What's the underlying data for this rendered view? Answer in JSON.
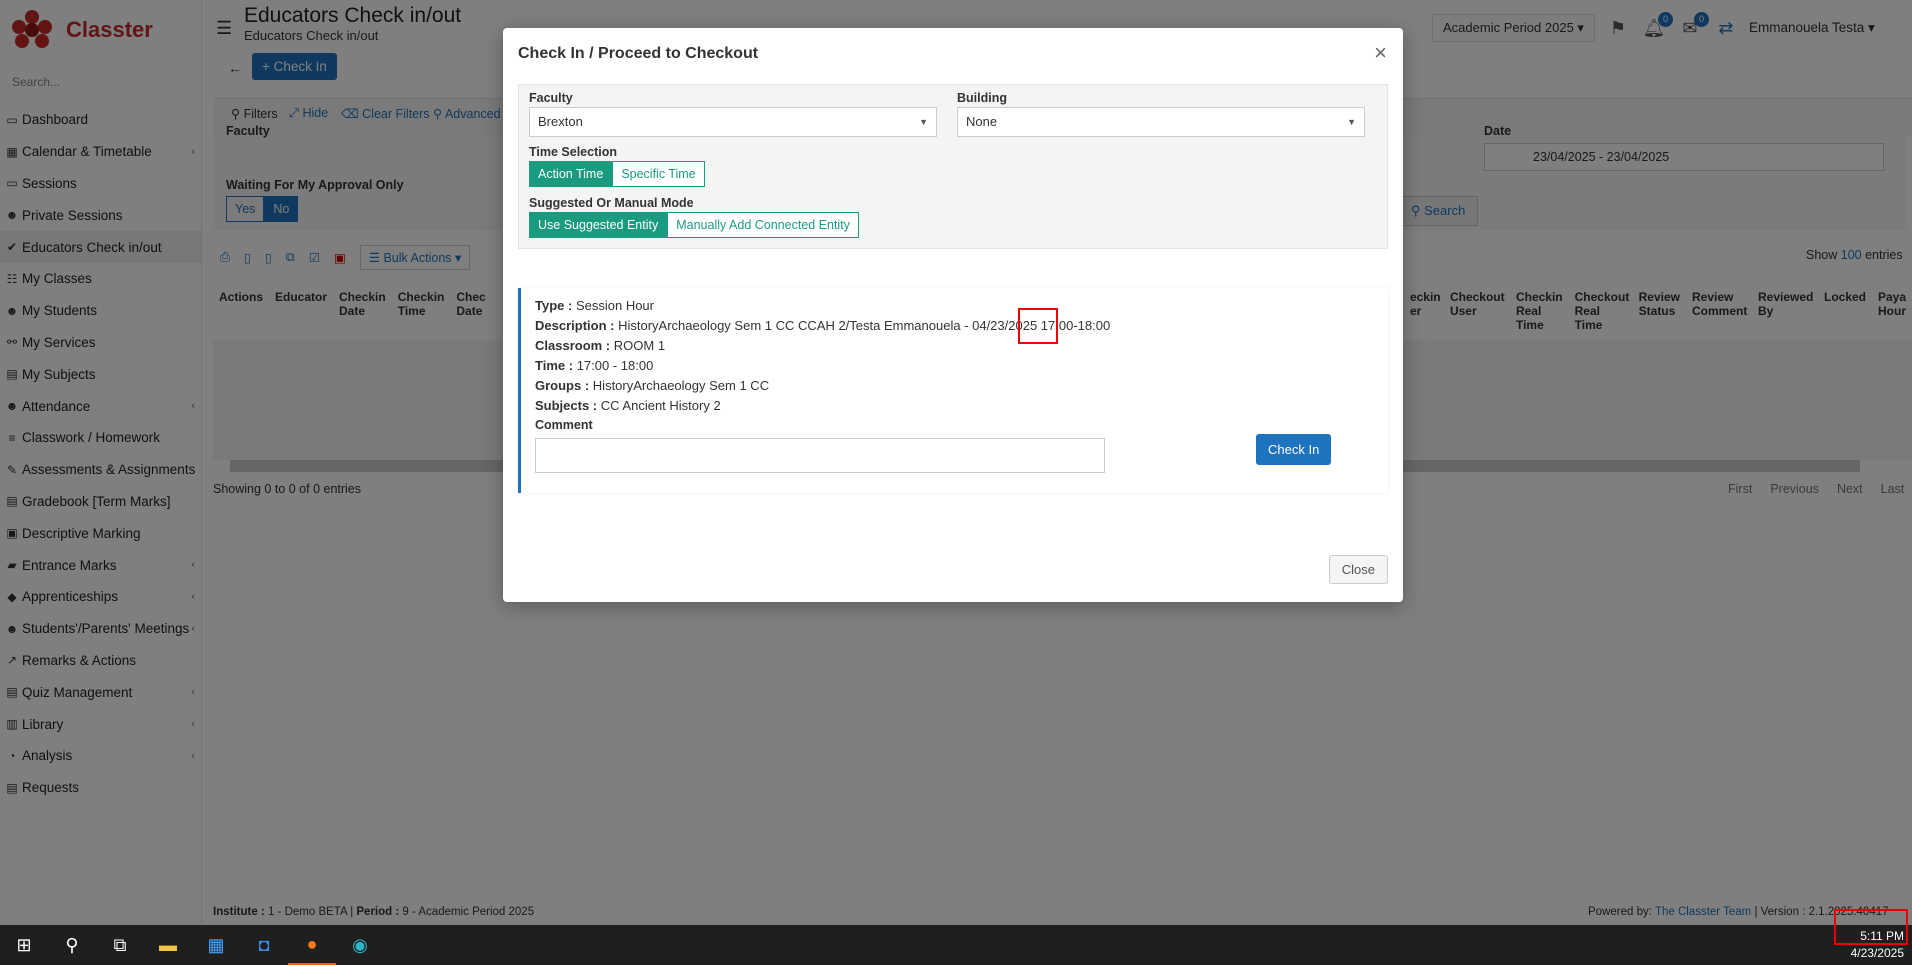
{
  "app": {
    "name": "Classter",
    "search_placeholder": "Search..."
  },
  "sidebar": {
    "items": [
      {
        "label": "Dashboard",
        "icon": "laptop-icon",
        "glyph": "▭",
        "arrow": false
      },
      {
        "label": "Calendar & Timetable",
        "icon": "calendar-icon",
        "glyph": "▦",
        "arrow": true
      },
      {
        "label": "Sessions",
        "icon": "sessions-icon",
        "glyph": "▭",
        "arrow": false
      },
      {
        "label": "Private Sessions",
        "icon": "users-icon",
        "glyph": "☻",
        "arrow": false
      },
      {
        "label": "Educators Check in/out",
        "icon": "check-icon",
        "glyph": "✔",
        "arrow": false,
        "active": true
      },
      {
        "label": "My Classes",
        "icon": "grid-icon",
        "glyph": "☷",
        "arrow": false
      },
      {
        "label": "My Students",
        "icon": "students-icon",
        "glyph": "☻",
        "arrow": false
      },
      {
        "label": "My Services",
        "icon": "services-icon",
        "glyph": "⚯",
        "arrow": false
      },
      {
        "label": "My Subjects",
        "icon": "subjects-icon",
        "glyph": "▤",
        "arrow": false
      },
      {
        "label": "Attendance",
        "icon": "attendance-icon",
        "glyph": "☻",
        "arrow": true
      },
      {
        "label": "Classwork / Homework",
        "icon": "homework-icon",
        "glyph": "≡",
        "arrow": false
      },
      {
        "label": "Assessments & Assignments",
        "icon": "edit-icon",
        "glyph": "✎",
        "arrow": false
      },
      {
        "label": "Gradebook [Term Marks]",
        "icon": "gradebook-icon",
        "glyph": "▤",
        "arrow": false
      },
      {
        "label": "Descriptive Marking",
        "icon": "marking-icon",
        "glyph": "▣",
        "arrow": false
      },
      {
        "label": "Entrance Marks",
        "icon": "entrance-icon",
        "glyph": "▰",
        "arrow": true
      },
      {
        "label": "Apprenticeships",
        "icon": "apprentice-icon",
        "glyph": "◆",
        "arrow": true
      },
      {
        "label": "Students'/Parents' Meetings",
        "icon": "meetings-icon",
        "glyph": "☻",
        "arrow": true
      },
      {
        "label": "Remarks & Actions",
        "icon": "remarks-icon",
        "glyph": "↗",
        "arrow": false
      },
      {
        "label": "Quiz Management",
        "icon": "quiz-icon",
        "glyph": "▤",
        "arrow": true
      },
      {
        "label": "Library",
        "icon": "library-icon",
        "glyph": "▥",
        "arrow": true
      },
      {
        "label": "Analysis",
        "icon": "analysis-icon",
        "glyph": "◔",
        "arrow": true
      },
      {
        "label": "Requests",
        "icon": "requests-icon",
        "glyph": "▤",
        "arrow": false
      }
    ]
  },
  "header": {
    "title": "Educators Check in/out",
    "subtitle": "Educators Check in/out",
    "period": "Academic Period 2025",
    "notif_count": "0",
    "mail_count": "0",
    "user": "Emmanouela Testa"
  },
  "page": {
    "checkin_label": "Check In",
    "filters": {
      "filters": "Filters",
      "hide": "Hide",
      "clear": "Clear Filters",
      "advanced": "Advanced F"
    },
    "faculty_label": "Faculty",
    "date_label": "Date",
    "date_value": "23/04/2025 - 23/04/2025",
    "waiting_label": "Waiting For My Approval Only",
    "yes": "Yes",
    "no": "No",
    "search": "Search",
    "bulk_actions": "Bulk Actions",
    "show": "Show",
    "show_count": "100",
    "entries": "entries",
    "columns": [
      "Actions",
      "Educator",
      "Checkin Date",
      "Checkin Time",
      "Chec Date",
      "eckin er",
      "Checkout User",
      "Checkin Real Time",
      "Checkout Real Time",
      "Review Status",
      "Review Comment",
      "Reviewed By",
      "Locked",
      "Paya Hour"
    ],
    "showing": "Showing 0 to 0 of 0 entries",
    "pager": [
      "First",
      "Previous",
      "Next",
      "Last"
    ]
  },
  "modal": {
    "title": "Check In / Proceed to Checkout",
    "faculty_label": "Faculty",
    "faculty_value": "Brexton",
    "building_label": "Building",
    "building_value": "None",
    "time_selection_label": "Time Selection",
    "time_options": [
      "Action Time",
      "Specific Time"
    ],
    "mode_label": "Suggested Or Manual Mode",
    "mode_options": [
      "Use Suggested Entity",
      "Manually Add Connected Entity"
    ],
    "type_label": "Type :",
    "type_value": "Session Hour",
    "description_label": "Description :",
    "description_value": "HistoryArchaeology Sem 1 CC CCAH 2/Testa Emmanouela - 04/23/2025 17:00-18:00",
    "classroom_label": "Classroom :",
    "classroom_value": "ROOM 1",
    "time_label": "Time :",
    "time_value": "17:00 - 18:00",
    "groups_label": "Groups :",
    "groups_value": "HistoryArchaeology Sem 1 CC",
    "subjects_label": "Subjects :",
    "subjects_value": "CC Ancient History 2",
    "comment_label": "Comment",
    "checkin_button": "Check In",
    "close_button": "Close"
  },
  "footer": {
    "institute_label": "Institute :",
    "institute_value": "1 - Demo BETA",
    "period_label": "Period :",
    "period_value": "9 - Academic Period 2025",
    "powered": "Powered by:",
    "team": "The Classter Team",
    "version": "| Version : 2.1.2025.40417"
  },
  "taskbar": {
    "time": "5:11 PM",
    "date": "4/23/2025"
  }
}
